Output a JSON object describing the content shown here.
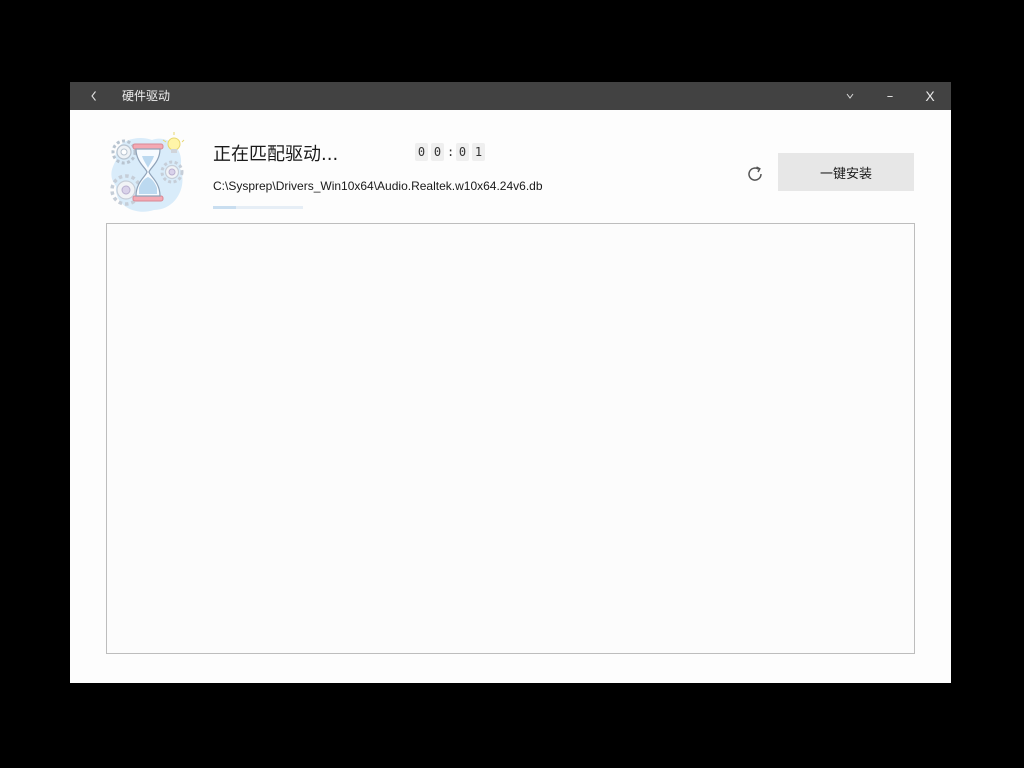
{
  "window": {
    "title": "硬件驱动",
    "back_icon": "chevron-left-icon",
    "menu_icon": "chevron-down-icon",
    "minimize_glyph": "–",
    "close_glyph": "X"
  },
  "status": {
    "title": "正在匹配驱动...",
    "timer_digits": [
      "0",
      "0",
      "0",
      "1"
    ],
    "timer_separator": ":",
    "file_path": "C:\\Sysprep\\Drivers_Win10x64\\Audio.Realtek.w10x64.24v6.db",
    "progress_percent": 25
  },
  "actions": {
    "refresh_icon": "refresh-icon",
    "install_label": "一键安装"
  },
  "colors": {
    "titlebar_bg": "#424242",
    "window_bg": "#fdfdfd",
    "button_bg": "#e7e7e7",
    "progress_fill": "#c9def0"
  }
}
